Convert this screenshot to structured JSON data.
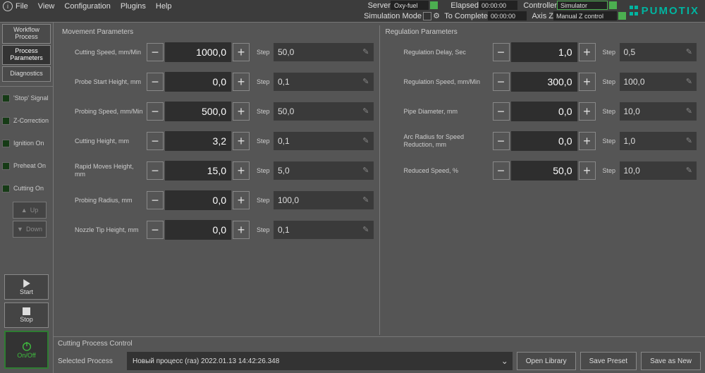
{
  "menu": {
    "file": "File",
    "view": "View",
    "config": "Configuration",
    "plugins": "Plugins",
    "help": "Help"
  },
  "status": {
    "server_lbl": "Server",
    "server_val": "Oxy-fuel",
    "elapsed_lbl": "Elapsed",
    "elapsed_val": "00:00:00",
    "controller_lbl": "Controller",
    "controller_val": "Simulator",
    "sim_lbl": "Simulation Mode",
    "tocomp_lbl": "To Complete",
    "tocomp_val": "00:00:00",
    "axisz_lbl": "Axis Z",
    "axisz_val": "Manual Z control"
  },
  "logo": "PUMOTIX",
  "left": {
    "workflow": "Workflow Process",
    "params": "Process Parameters",
    "diag": "Diagnostics",
    "stop_sig": "'Stop' Signal",
    "zcorr": "Z-Correction",
    "ign": "Ignition On",
    "preheat": "Preheat On",
    "cutting": "Cutting On",
    "up": "Up",
    "down": "Down",
    "start": "Start",
    "stop": "Stop",
    "onoff": "On/Off"
  },
  "movement": {
    "title": "Movement Parameters",
    "rows": [
      {
        "label": "Cutting Speed, mm/Min",
        "value": "1000,0",
        "step": "50,0"
      },
      {
        "label": "Probe Start Height, mm",
        "value": "0,0",
        "step": "0,1"
      },
      {
        "label": "Probing Speed, mm/Min",
        "value": "500,0",
        "step": "50,0"
      },
      {
        "label": "Cutting Height, mm",
        "value": "3,2",
        "step": "0,1"
      },
      {
        "label": "Rapid Moves Height, mm",
        "value": "15,0",
        "step": "5,0"
      },
      {
        "label": "Probing Radius, mm",
        "value": "0,0",
        "step": "100,0"
      },
      {
        "label": "Nozzle Tip Height, mm",
        "value": "0,0",
        "step": "0,1"
      }
    ],
    "step_lbl": "Step"
  },
  "regulation": {
    "title": "Regulation Parameters",
    "rows": [
      {
        "label": "Regulation Delay, Sec",
        "value": "1,0",
        "step": "0,5"
      },
      {
        "label": "Regulation Speed, mm/Min",
        "value": "300,0",
        "step": "100,0"
      },
      {
        "label": "Pipe Diameter, mm",
        "value": "0,0",
        "step": "10,0"
      },
      {
        "label": "Arc Radius for Speed Reduction, mm",
        "value": "0,0",
        "step": "1,0"
      },
      {
        "label": "Reduced Speed, %",
        "value": "50,0",
        "step": "10,0"
      }
    ],
    "step_lbl": "Step"
  },
  "bottom": {
    "title": "Cutting Process Control",
    "selected_lbl": "Selected Process",
    "selected_val": "Новый процесс (газ) 2022.01.13 14:42:26.348",
    "open": "Open Library",
    "save": "Save Preset",
    "saveas": "Save as New"
  }
}
